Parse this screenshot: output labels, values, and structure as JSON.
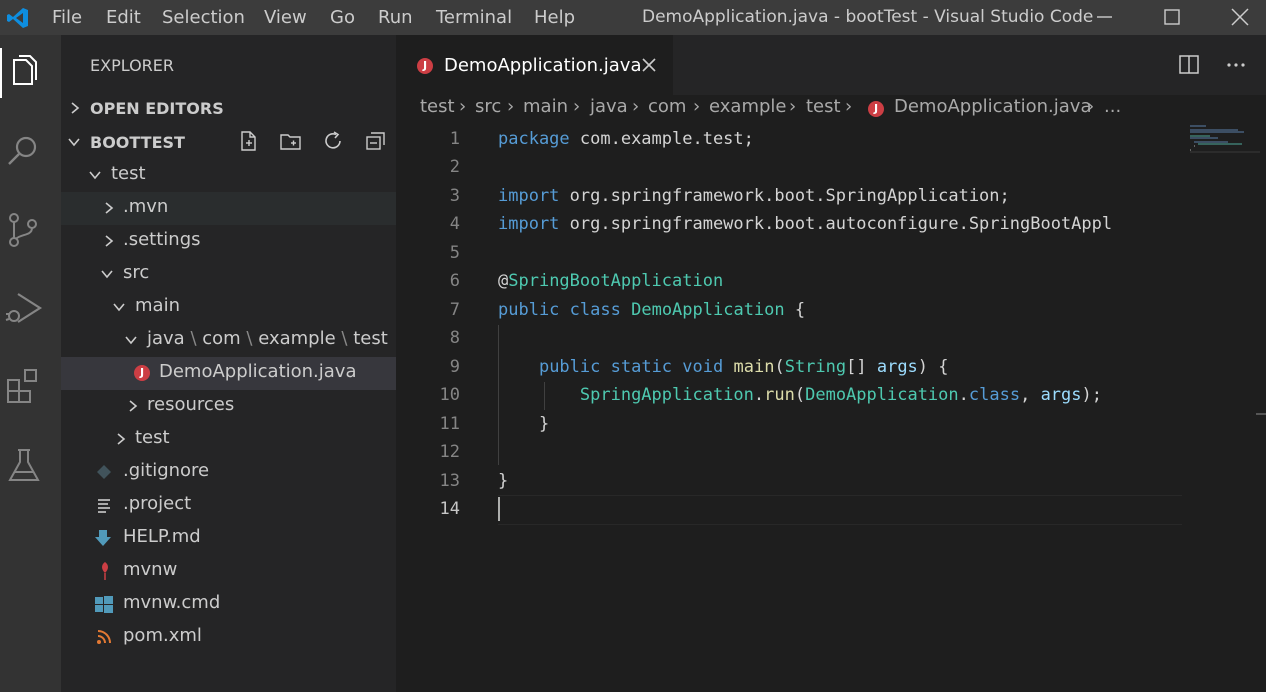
{
  "titlebar": {
    "menu": [
      "File",
      "Edit",
      "Selection",
      "View",
      "Go",
      "Run",
      "Terminal",
      "Help"
    ],
    "title": "DemoApplication.java - bootTest - Visual Studio Code"
  },
  "activity": [
    "explorer-icon",
    "search-icon",
    "source-control-icon",
    "run-debug-icon",
    "extensions-icon",
    "testing-icon"
  ],
  "sidebar": {
    "title": "EXPLORER",
    "open_editors": "OPEN EDITORS",
    "project": "BOOTTEST",
    "tree": [
      {
        "label": "test"
      },
      {
        "label": ".mvn"
      },
      {
        "label": ".settings"
      },
      {
        "label": "src"
      },
      {
        "label": "main"
      },
      {
        "label_parts": [
          "java",
          "com",
          "example",
          "test"
        ]
      },
      {
        "label": "DemoApplication.java"
      },
      {
        "label": "resources"
      },
      {
        "label": "test"
      },
      {
        "label": ".gitignore"
      },
      {
        "label": ".project"
      },
      {
        "label": "HELP.md"
      },
      {
        "label": "mvnw"
      },
      {
        "label": "mvnw.cmd"
      },
      {
        "label": "pom.xml"
      }
    ]
  },
  "editor": {
    "tab": {
      "label": "DemoApplication.java"
    },
    "breadcrumb": [
      "test",
      "src",
      "main",
      "java",
      "com",
      "example",
      "test",
      "DemoApplication.java",
      "..."
    ],
    "line_numbers": [
      "1",
      "2",
      "3",
      "4",
      "5",
      "6",
      "7",
      "8",
      "9",
      "10",
      "11",
      "12",
      "13",
      "14"
    ],
    "code": {
      "l1_kw": "package",
      "l1_rest": " com.example.test;",
      "l3_kw": "import",
      "l3_rest": " org.springframework.boot.SpringApplication;",
      "l4_kw": "import",
      "l4_rest": " org.springframework.boot.autoconfigure.SpringBootAppl",
      "l6_at": "@",
      "l6_ann": "SpringBootApplication",
      "l7_kw1": "public",
      "l7_kw2": "class",
      "l7_cls": "DemoApplication",
      "l7_rest": " {",
      "l9_kw1": "public",
      "l9_kw2": "static",
      "l9_kw3": "void",
      "l9_fn": "main",
      "l9_p1": "(",
      "l9_ty": "String",
      "l9_p2": "[] ",
      "l9_arg": "args",
      "l9_p3": ") {",
      "l10_cls": "SpringApplication",
      "l10_dot": ".",
      "l10_fn": "run",
      "l10_p1": "(",
      "l10_cls2": "DemoApplication",
      "l10_dot2": ".",
      "l10_kw": "class",
      "l10_p2": ", ",
      "l10_arg": "args",
      "l10_p3": ");",
      "l11": "}",
      "l13": "}"
    }
  }
}
